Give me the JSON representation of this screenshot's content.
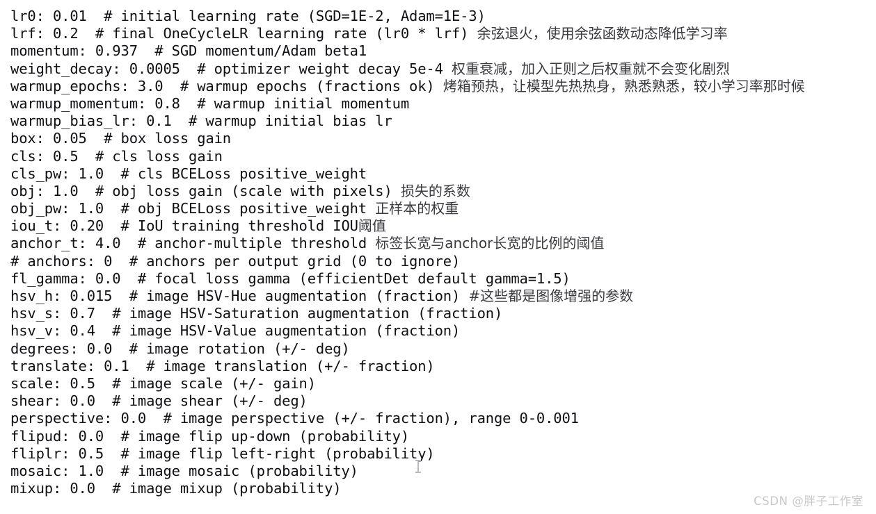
{
  "document": {
    "kind": "yaml-hyperparameter-file",
    "lines": [
      {
        "code": "lr0: 0.01  # initial learning rate (SGD=1E-2, Adam=1E-3)",
        "note": ""
      },
      {
        "code": "lrf: 0.2  # final OneCycleLR learning rate (lr0 * lrf) ",
        "note": "余弦退火，使用余弦函数动态降低学习率"
      },
      {
        "code": "momentum: 0.937  # SGD momentum/Adam beta1",
        "note": ""
      },
      {
        "code": "weight_decay: 0.0005  # optimizer weight decay 5e-4 ",
        "note": "权重衰减，加入正则之后权重就不会变化剧烈"
      },
      {
        "code": "warmup_epochs: 3.0  # warmup epochs (fractions ok) ",
        "note": "烤箱预热，让模型先热热身，熟悉熟悉，较小学习率那时候"
      },
      {
        "code": "warmup_momentum: 0.8  # warmup initial momentum",
        "note": ""
      },
      {
        "code": "warmup_bias_lr: 0.1  # warmup initial bias lr",
        "note": ""
      },
      {
        "code": "box: 0.05  # box loss gain",
        "note": ""
      },
      {
        "code": "cls: 0.5  # cls loss gain",
        "note": ""
      },
      {
        "code": "cls_pw: 1.0  # cls BCELoss positive_weight",
        "note": ""
      },
      {
        "code": "obj: 1.0  # obj loss gain (scale with pixels) ",
        "note": "损失的系数"
      },
      {
        "code": "obj_pw: 1.0  # obj BCELoss positive_weight ",
        "note": "正样本的权重"
      },
      {
        "code": "iou_t: 0.20  # IoU training threshold IOU",
        "note": "阈值"
      },
      {
        "code": "anchor_t: 4.0  # anchor-multiple threshold ",
        "note": "标签长宽与anchor长宽的比例的阈值"
      },
      {
        "code": "# anchors: 0  # anchors per output grid (0 to ignore)",
        "note": ""
      },
      {
        "code": "fl_gamma: 0.0  # focal loss gamma (efficientDet default gamma=1.5)",
        "note": ""
      },
      {
        "code": "hsv_h: 0.015  # image HSV-Hue augmentation (fraction) ",
        "note": "#这些都是图像增强的参数"
      },
      {
        "code": "hsv_s: 0.7  # image HSV-Saturation augmentation (fraction)",
        "note": ""
      },
      {
        "code": "hsv_v: 0.4  # image HSV-Value augmentation (fraction)",
        "note": ""
      },
      {
        "code": "degrees: 0.0  # image rotation (+/- deg)",
        "note": ""
      },
      {
        "code": "translate: 0.1  # image translation (+/- fraction)",
        "note": ""
      },
      {
        "code": "scale: 0.5  # image scale (+/- gain)",
        "note": ""
      },
      {
        "code": "shear: 0.0  # image shear (+/- deg)",
        "note": ""
      },
      {
        "code": "perspective: 0.0  # image perspective (+/- fraction), range 0-0.001",
        "note": ""
      },
      {
        "code": "flipud: 0.0  # image flip up-down (probability)",
        "note": ""
      },
      {
        "code": "fliplr: 0.5  # image flip left-right (probability)",
        "note": ""
      },
      {
        "code": "mosaic: 1.0  # image mosaic (probability)",
        "note": ""
      },
      {
        "code": "mixup: 0.0  # image mixup (probability)",
        "note": ""
      }
    ]
  },
  "watermark": {
    "text": "CSDN @胖子工作室"
  },
  "colors": {
    "background": "#ffffff",
    "code_text": "#101014",
    "annotation_text": "#3a3a40",
    "watermark_text": "#c9c9cd",
    "caret": "#b9b9bf"
  }
}
